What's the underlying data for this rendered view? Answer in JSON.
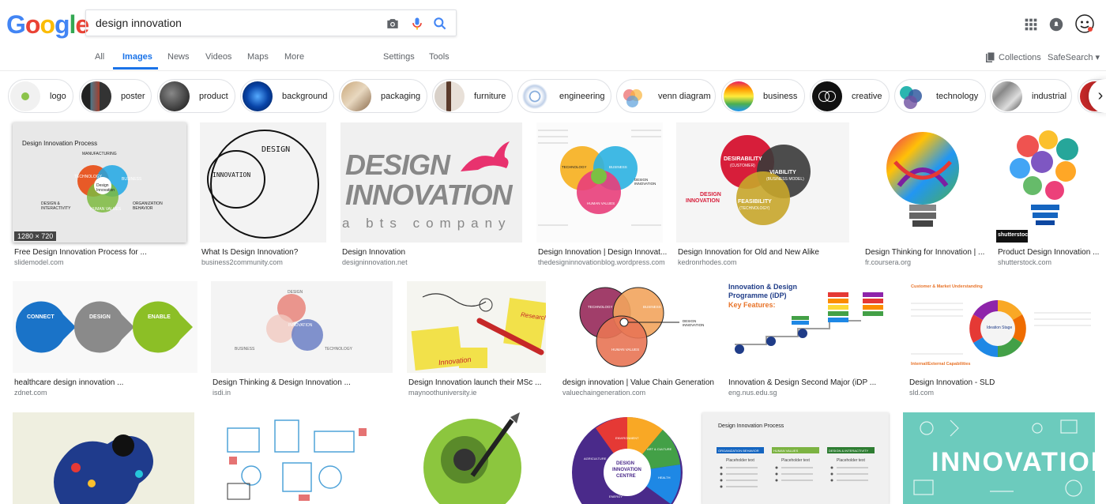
{
  "search": {
    "query": "design innovation"
  },
  "logo_letters": [
    {
      "ch": "G",
      "color": "#4285f4"
    },
    {
      "ch": "o",
      "color": "#ea4335"
    },
    {
      "ch": "o",
      "color": "#fbbc05"
    },
    {
      "ch": "g",
      "color": "#4285f4"
    },
    {
      "ch": "l",
      "color": "#34a853"
    },
    {
      "ch": "e",
      "color": "#ea4335"
    }
  ],
  "nav": {
    "all": "All",
    "images": "Images",
    "news": "News",
    "videos": "Videos",
    "maps": "Maps",
    "more": "More",
    "settings": "Settings",
    "tools": "Tools"
  },
  "header_right": {
    "collections": "Collections",
    "safesearch": "SafeSearch ▾"
  },
  "chips": [
    {
      "label": "logo"
    },
    {
      "label": "poster"
    },
    {
      "label": "product"
    },
    {
      "label": "background"
    },
    {
      "label": "packaging"
    },
    {
      "label": "furniture"
    },
    {
      "label": "engineering"
    },
    {
      "label": "venn diagram"
    },
    {
      "label": "business"
    },
    {
      "label": "creative"
    },
    {
      "label": "technology"
    },
    {
      "label": "industrial"
    }
  ],
  "results": {
    "row1": [
      {
        "title": "Free Design Innovation Process for ...",
        "site": "slidemodel.com",
        "dims": "1280 × 720",
        "thumb_title": "Design Innovation Process",
        "venn": [
          "MANUFACTURING",
          "DESIGN & INTERACTIVITY",
          "ORGANIZATION BEHAVIOR",
          "BUSINESS",
          "HUMAN VALUES",
          "TECHNOLOGY",
          "Design Innovation"
        ]
      },
      {
        "title": "What Is Design Innovation?",
        "site": "business2community.com",
        "words": [
          "DESIGN",
          "INNOVATION"
        ]
      },
      {
        "title": "Design Innovation",
        "site": "designinnovation.net",
        "big": [
          "DESIGN",
          "INNOVATION"
        ],
        "tag": "a  bts  company"
      },
      {
        "title": "Design Innovation | Design Innovat...",
        "site": "thedesigninnovationblog.wordpress.com",
        "venn": [
          "TECHNOLOGY",
          "BUSINESS",
          "HUMAN VALUES",
          "DESIGN INNOVATION"
        ]
      },
      {
        "title": "Design Innovation for Old and New Alike",
        "site": "kedronrhodes.com",
        "venn": [
          "DESIRABILITY",
          "(CUSTOMER)",
          "VIABILITY",
          "(BUSINESS MODEL)",
          "FEASIBILITY",
          "(TECHNOLOGY)",
          "DESIGN",
          "INNOVATION"
        ]
      },
      {
        "title": "Design Thinking for Innovation | ...",
        "site": "fr.coursera.org"
      },
      {
        "title": "Product Design Innovation ...",
        "site": "shutterstock.com",
        "mark": "shutterstock"
      }
    ],
    "row2": [
      {
        "title": "healthcare design innovation ...",
        "site": "zdnet.com",
        "steps": [
          "CONNECT",
          "DESIGN",
          "ENABLE"
        ]
      },
      {
        "title": "Design Thinking & Design Innovation ...",
        "site": "isdi.in",
        "venn": [
          "DESIGN",
          "INNOVATION",
          "BUSINESS",
          "TECHNOLOGY"
        ]
      },
      {
        "title": "Design Innovation launch their MSc ...",
        "site": "maynoothuniversity.ie",
        "words": [
          "Innovation",
          "Research"
        ]
      },
      {
        "title": "design innovation | Value Chain Generation",
        "site": "valuechaingeneration.com",
        "venn": [
          "TECHNOLOGY",
          "BUSINESS",
          "HUMAN VALUES",
          "DESIGN INNOVATION"
        ]
      },
      {
        "title": "Innovation & Design Second Major (iDP ...",
        "site": "eng.nus.edu.sg",
        "heading": [
          "Innovation & Design",
          "Programme (iDP)",
          "Key Features:"
        ]
      },
      {
        "title": "Design Innovation - SLD",
        "site": "sld.com",
        "words": [
          "Customer & Market Understanding",
          "Ideation Stage",
          "Internal/External Capabilities"
        ]
      }
    ],
    "row3": [
      {
        "title": "",
        "site": ""
      },
      {
        "title": "",
        "site": ""
      },
      {
        "title": "",
        "site": ""
      },
      {
        "title": "",
        "site": "",
        "words": [
          "DESIGN",
          "INNOVATION",
          "CENTRE",
          "ENVIRONMENT",
          "ART & CULTURE",
          "HEALTH",
          "ENERGY",
          "AGRICULTURE"
        ]
      },
      {
        "title": "",
        "site": "",
        "thumb_title": "Design Innovation Process",
        "cols": [
          "ORGANIZATION BEHAVIOR",
          "HUMAN VALUES",
          "DESIGN & INTERACTIVITY"
        ],
        "item": "Placeholder text"
      },
      {
        "title": "",
        "site": "",
        "big": [
          "INNOVATION"
        ]
      }
    ]
  },
  "colors": {
    "accent": "#1a73e8",
    "muted": "#5f6368",
    "site": "#70757a"
  }
}
